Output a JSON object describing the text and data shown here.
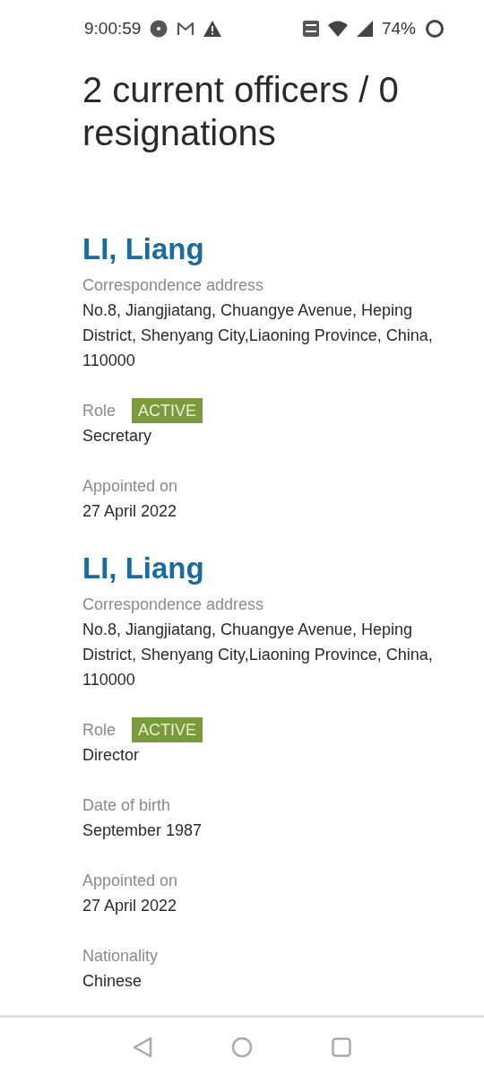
{
  "status_bar": {
    "time": "9:00:59",
    "battery": "74%"
  },
  "title": "2 current officers / 0 resignations",
  "officers": [
    {
      "name": "LI, Liang",
      "fields": [
        {
          "kind": "text",
          "label": "Correspondence address",
          "value": "No.8, Jiangjiatang, Chuangye Avenue, Heping District, Shenyang City,Liaoning Province, China, 110000"
        },
        {
          "kind": "role",
          "label": "Role",
          "badge": "ACTIVE",
          "color": "#7a9a3c",
          "value": "Secretary"
        },
        {
          "kind": "text",
          "label": "Appointed on",
          "value": "27 April 2022"
        }
      ]
    },
    {
      "name": "LI, Liang",
      "fields": [
        {
          "kind": "text",
          "label": "Correspondence address",
          "value": "No.8, Jiangjiatang, Chuangye Avenue, Heping District, Shenyang City,Liaoning Province, China, 110000"
        },
        {
          "kind": "role",
          "label": "Role",
          "badge": "ACTIVE",
          "color": "#7a9a3c",
          "value": "Director"
        },
        {
          "kind": "text",
          "label": "Date of birth",
          "value": "September 1987"
        },
        {
          "kind": "text",
          "label": "Appointed on",
          "value": "27 April 2022"
        },
        {
          "kind": "text",
          "label": "Nationality",
          "value": "Chinese"
        }
      ]
    }
  ]
}
